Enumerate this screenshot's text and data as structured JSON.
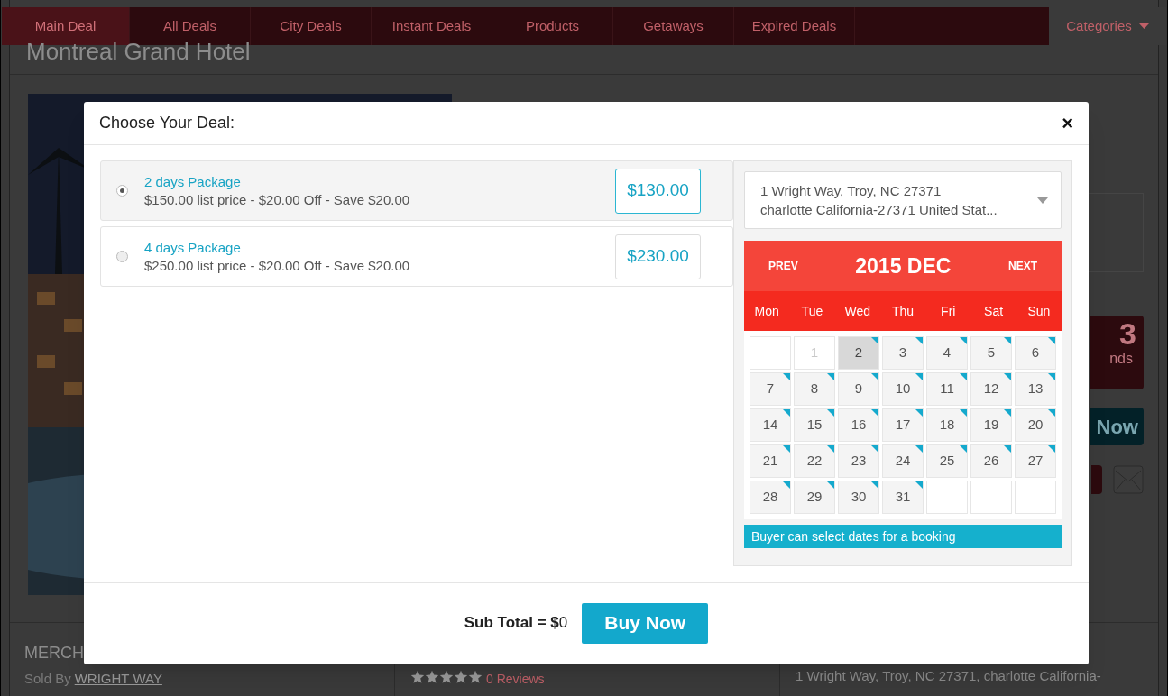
{
  "nav": {
    "items": [
      {
        "label": "Main Deal",
        "selected": true
      },
      {
        "label": "All Deals",
        "selected": false
      },
      {
        "label": "City Deals",
        "selected": false
      },
      {
        "label": "Instant Deals",
        "selected": false
      },
      {
        "label": "Products",
        "selected": false
      },
      {
        "label": "Getaways",
        "selected": false
      },
      {
        "label": "Expired Deals",
        "selected": false
      }
    ],
    "categories": "Categories"
  },
  "page": {
    "title": "Montreal Grand Hotel",
    "counter": "3",
    "counter_label": "nds",
    "buy_button": "Now",
    "merchant_heading": "MERCH",
    "sold_by": "Sold By",
    "seller": "WRIGHT WAY",
    "stars": 5,
    "reviews": "0 Reviews",
    "address": "1 Wright Way, Troy, NC 27371, charlotte California-"
  },
  "modal": {
    "title": "Choose Your Deal:",
    "close": "×",
    "deals": [
      {
        "name": "2 days Package",
        "detail": "$150.00 list price - $20.00 Off - Save $20.00",
        "price": "$130.00",
        "selected": true
      },
      {
        "name": "4 days Package",
        "detail": "$250.00 list price - $20.00 Off - Save $20.00",
        "price": "$230.00",
        "selected": false
      }
    ],
    "location": {
      "line1": "1 Wright Way, Troy, NC 27371",
      "line2": "charlotte California-27371 United Stat..."
    },
    "calendar": {
      "prev": "PREV",
      "title": "2015 DEC",
      "next": "NEXT",
      "weekdays": [
        "Mon",
        "Tue",
        "Wed",
        "Thu",
        "Fri",
        "Sat",
        "Sun"
      ],
      "days": [
        {
          "kind": "empty"
        },
        {
          "kind": "day",
          "label": "1",
          "disabled": true,
          "available": false,
          "selected": false
        },
        {
          "kind": "day",
          "label": "2",
          "disabled": false,
          "available": true,
          "selected": true
        },
        {
          "kind": "day",
          "label": "3",
          "disabled": false,
          "available": true,
          "selected": false
        },
        {
          "kind": "day",
          "label": "4",
          "disabled": false,
          "available": true,
          "selected": false
        },
        {
          "kind": "day",
          "label": "5",
          "disabled": false,
          "available": true,
          "selected": false
        },
        {
          "kind": "day",
          "label": "6",
          "disabled": false,
          "available": true,
          "selected": false
        },
        {
          "kind": "day",
          "label": "7",
          "disabled": false,
          "available": true,
          "selected": false
        },
        {
          "kind": "day",
          "label": "8",
          "disabled": false,
          "available": true,
          "selected": false
        },
        {
          "kind": "day",
          "label": "9",
          "disabled": false,
          "available": true,
          "selected": false
        },
        {
          "kind": "day",
          "label": "10",
          "disabled": false,
          "available": true,
          "selected": false
        },
        {
          "kind": "day",
          "label": "11",
          "disabled": false,
          "available": true,
          "selected": false
        },
        {
          "kind": "day",
          "label": "12",
          "disabled": false,
          "available": true,
          "selected": false
        },
        {
          "kind": "day",
          "label": "13",
          "disabled": false,
          "available": true,
          "selected": false
        },
        {
          "kind": "day",
          "label": "14",
          "disabled": false,
          "available": true,
          "selected": false
        },
        {
          "kind": "day",
          "label": "15",
          "disabled": false,
          "available": true,
          "selected": false
        },
        {
          "kind": "day",
          "label": "16",
          "disabled": false,
          "available": true,
          "selected": false
        },
        {
          "kind": "day",
          "label": "17",
          "disabled": false,
          "available": true,
          "selected": false
        },
        {
          "kind": "day",
          "label": "18",
          "disabled": false,
          "available": true,
          "selected": false
        },
        {
          "kind": "day",
          "label": "19",
          "disabled": false,
          "available": true,
          "selected": false
        },
        {
          "kind": "day",
          "label": "20",
          "disabled": false,
          "available": true,
          "selected": false
        },
        {
          "kind": "day",
          "label": "21",
          "disabled": false,
          "available": true,
          "selected": false
        },
        {
          "kind": "day",
          "label": "22",
          "disabled": false,
          "available": true,
          "selected": false
        },
        {
          "kind": "day",
          "label": "23",
          "disabled": false,
          "available": true,
          "selected": false
        },
        {
          "kind": "day",
          "label": "24",
          "disabled": false,
          "available": true,
          "selected": false
        },
        {
          "kind": "day",
          "label": "25",
          "disabled": false,
          "available": true,
          "selected": false
        },
        {
          "kind": "day",
          "label": "26",
          "disabled": false,
          "available": true,
          "selected": false
        },
        {
          "kind": "day",
          "label": "27",
          "disabled": false,
          "available": true,
          "selected": false
        },
        {
          "kind": "day",
          "label": "28",
          "disabled": false,
          "available": true,
          "selected": false
        },
        {
          "kind": "day",
          "label": "29",
          "disabled": false,
          "available": true,
          "selected": false
        },
        {
          "kind": "day",
          "label": "30",
          "disabled": false,
          "available": true,
          "selected": false
        },
        {
          "kind": "day",
          "label": "31",
          "disabled": false,
          "available": true,
          "selected": false
        },
        {
          "kind": "empty"
        },
        {
          "kind": "empty"
        },
        {
          "kind": "empty"
        }
      ],
      "note": "Buyer can select dates for a booking"
    },
    "subtotal": "**Sub Total = $**0",
    "buy_button": "Buy Now"
  }
}
